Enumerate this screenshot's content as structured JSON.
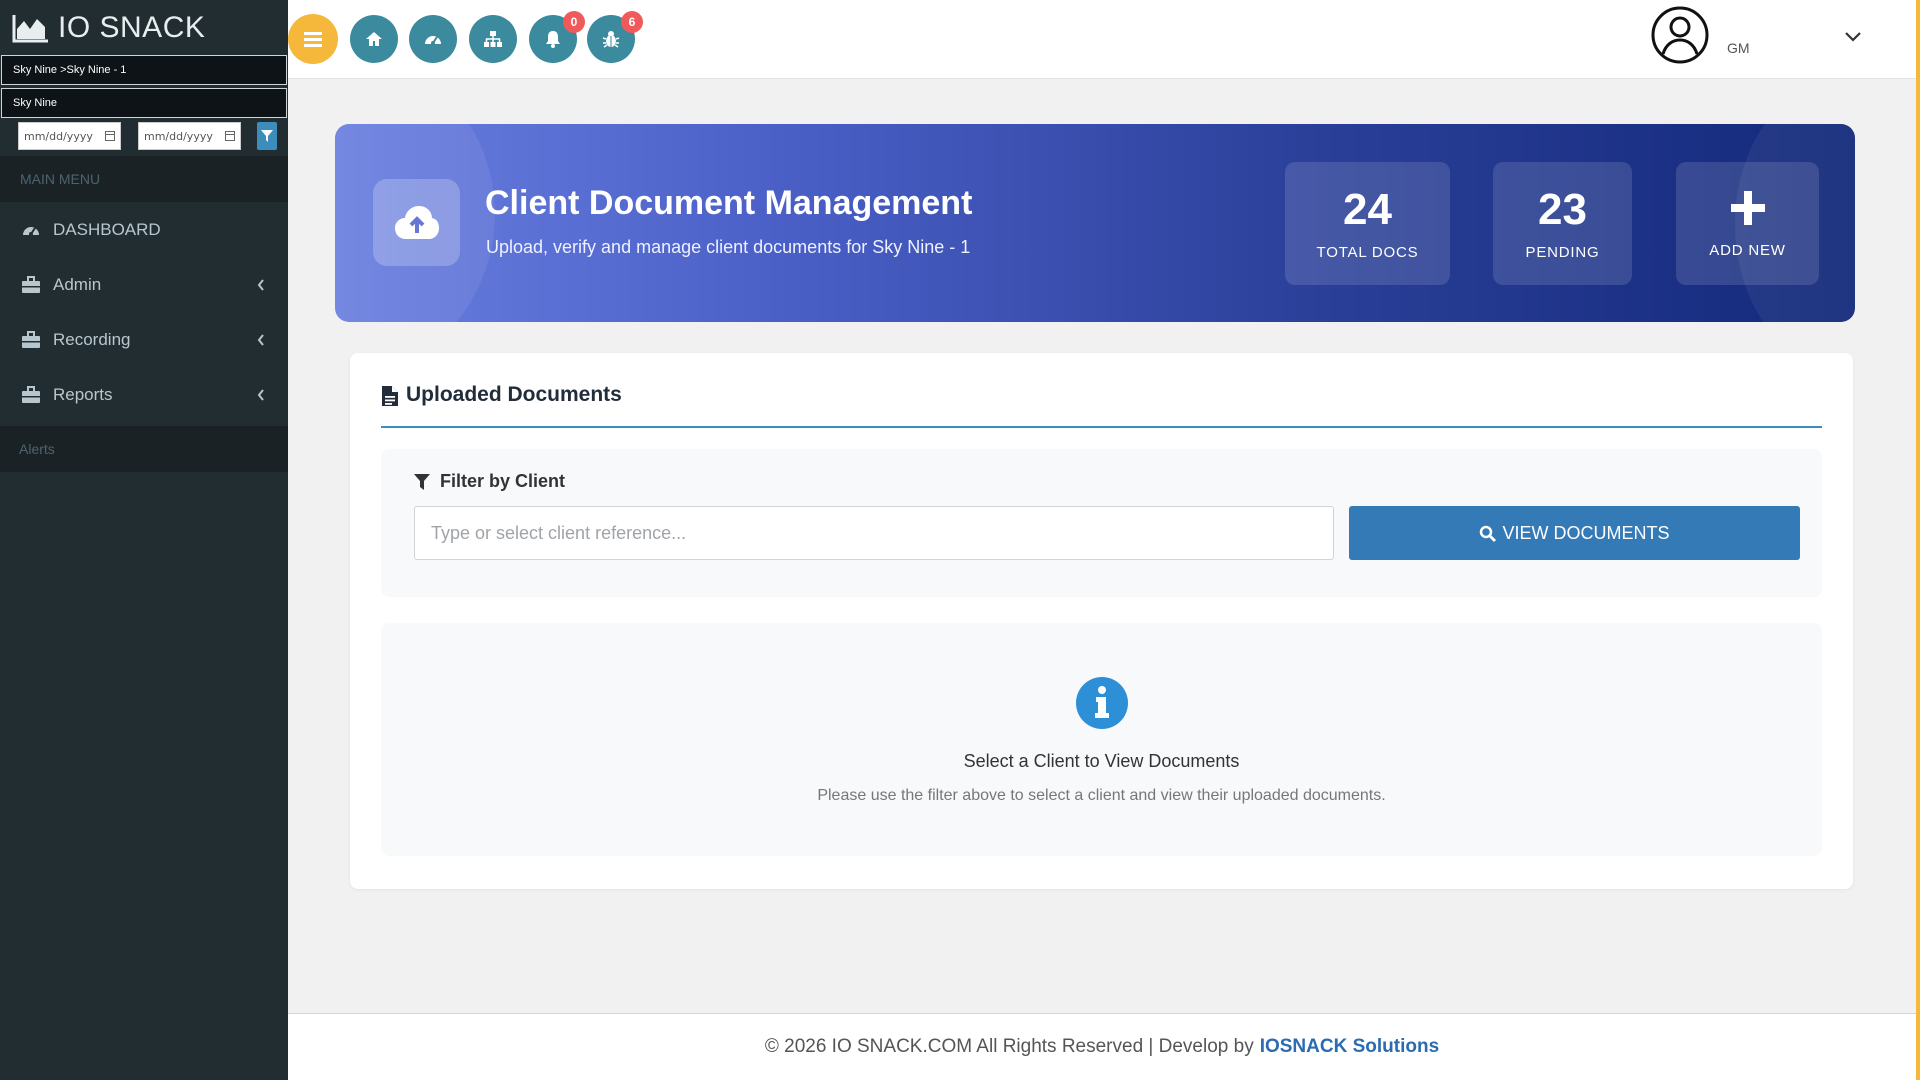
{
  "brand": {
    "name": "IO SNACK"
  },
  "sidebar": {
    "location_path": "Sky Nine >Sky Nine - 1",
    "location": "Sky Nine",
    "date_from_placeholder": "mm/dd/yyyy",
    "date_to_placeholder": "mm/dd/yyyy",
    "main_menu_header": "MAIN MENU",
    "items": [
      {
        "label": "DASHBOARD",
        "icon": "dashboard-icon"
      },
      {
        "label": "Admin",
        "icon": "briefcase-icon"
      },
      {
        "label": "Recording",
        "icon": "briefcase-icon"
      },
      {
        "label": "Reports",
        "icon": "briefcase-icon"
      }
    ],
    "alerts_header": "Alerts"
  },
  "topbar": {
    "notifications_count": "0",
    "bugs_count": "6",
    "user_initials": "GM"
  },
  "hero": {
    "title": "Client Document Management",
    "subtitle": "Upload, verify and manage client documents for Sky Nine - 1",
    "stats": [
      {
        "value": "24",
        "label": "TOTAL DOCS"
      },
      {
        "value": "23",
        "label": "PENDING"
      }
    ],
    "add_label": "ADD NEW"
  },
  "card": {
    "title": "Uploaded Documents",
    "filter_label": "Filter by Client",
    "client_placeholder": "Type or select client reference...",
    "view_button": "VIEW DOCUMENTS",
    "empty_title": "Select a Client to View Documents",
    "empty_desc": "Please use the filter above to select a client and view their uploaded documents."
  },
  "footer": {
    "copyright": "© 2026 IO SNACK.COM All Rights Reserved | Develop by",
    "developer": "IOSNACK Solutions"
  },
  "colors": {
    "sidebar_bg": "#222d32",
    "accent_yellow": "#f6b83b",
    "teal_button": "#3b8a9e",
    "primary_blue": "#337ab7",
    "badge_red": "#f05a5a"
  }
}
